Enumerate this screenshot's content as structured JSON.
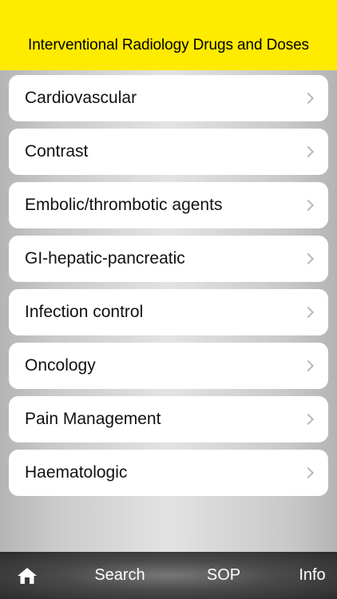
{
  "header": {
    "title": "Interventional Radiology Drugs and Doses"
  },
  "categories": [
    {
      "label": "Cardiovascular"
    },
    {
      "label": "Contrast"
    },
    {
      "label": "Embolic/thrombotic agents"
    },
    {
      "label": "GI-hepatic-pancreatic"
    },
    {
      "label": "Infection control"
    },
    {
      "label": "Oncology"
    },
    {
      "label": "Pain Management"
    },
    {
      "label": "Haematologic"
    }
  ],
  "tabbar": {
    "home_icon": "home-icon",
    "search_label": "Search",
    "sop_label": "SOP",
    "info_label": "Info"
  },
  "colors": {
    "header_bg": "#ffeb00",
    "tabbar_bg": "#3a3a3a"
  }
}
